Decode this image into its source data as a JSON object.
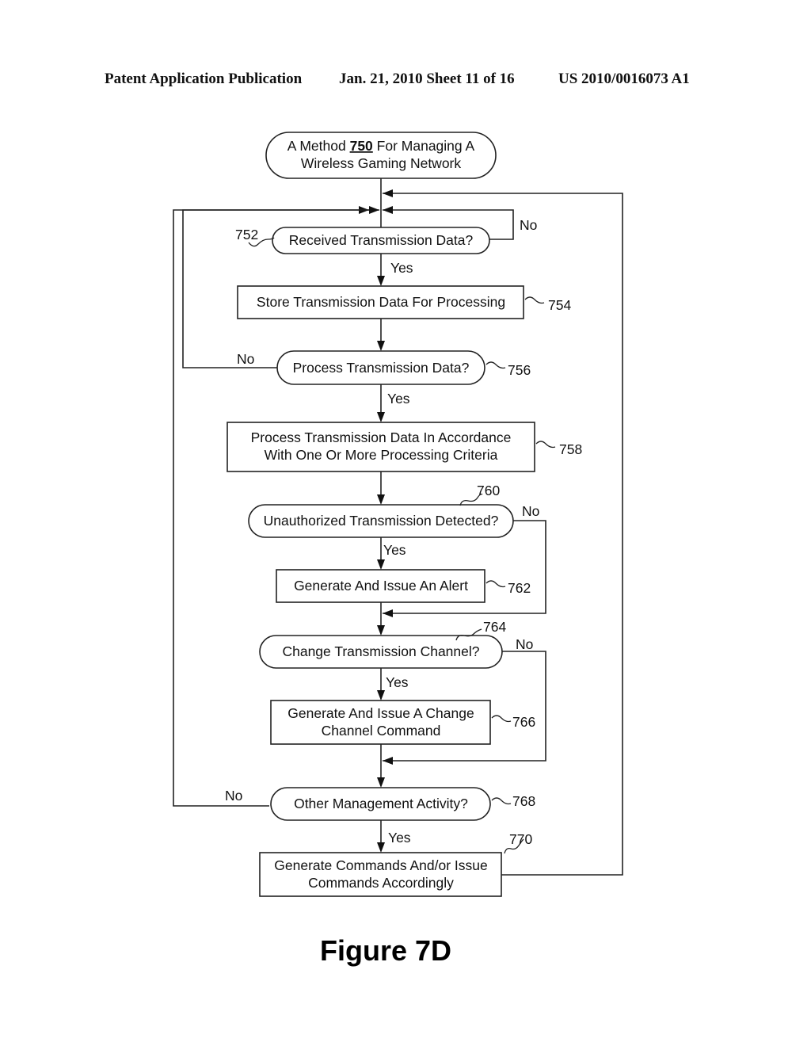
{
  "header": {
    "left": "Patent Application Publication",
    "middle": "Jan. 21, 2010  Sheet 11 of 16",
    "right": "US 2010/0016073 A1"
  },
  "flowchart": {
    "start": {
      "line1_prefix": "A Method ",
      "line1_ref": "750",
      "line1_suffix": " For Managing A",
      "line2": "Wireless Gaming Network"
    },
    "steps": {
      "s752": {
        "ref": "752",
        "text": "Received Transmission Data?",
        "type": "decision"
      },
      "s754": {
        "ref": "754",
        "text": "Store Transmission Data For Processing",
        "type": "process"
      },
      "s756": {
        "ref": "756",
        "text": "Process Transmission Data?",
        "type": "decision"
      },
      "s758": {
        "ref": "758",
        "line1": "Process Transmission Data In Accordance",
        "line2": "With One Or More Processing Criteria",
        "type": "process"
      },
      "s760": {
        "ref": "760",
        "text": "Unauthorized Transmission Detected?",
        "type": "decision"
      },
      "s762": {
        "ref": "762",
        "text": "Generate And Issue An Alert",
        "type": "process"
      },
      "s764": {
        "ref": "764",
        "text": "Change Transmission Channel?",
        "type": "decision"
      },
      "s766": {
        "ref": "766",
        "line1": "Generate And Issue A Change",
        "line2": "Channel Command",
        "type": "process"
      },
      "s768": {
        "ref": "768",
        "text": "Other Management Activity?",
        "type": "decision"
      },
      "s770": {
        "ref": "770",
        "line1": "Generate Commands And/or Issue",
        "line2": "Commands Accordingly",
        "type": "process"
      }
    },
    "labels": {
      "yes": "Yes",
      "no": "No"
    }
  },
  "figure_caption": "Figure 7D"
}
